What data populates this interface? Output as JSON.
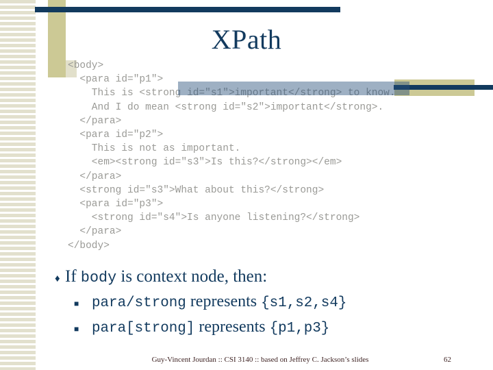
{
  "slide": {
    "title": "XPath",
    "colors": {
      "navy": "#123a5e",
      "khaki": "#ccc995",
      "stripe": "#e2e0cd",
      "code_gray": "#9a9a96",
      "footer_text": "#3b1f1f",
      "band_overlay": "rgba(41,80,122,0.45)"
    }
  },
  "code": {
    "language": "xml",
    "lines": [
      "<body>",
      "  <para id=\"p1\">",
      "    This is <strong id=\"s1\">important</strong> to know.",
      "    And I do mean <strong id=\"s2\">important</strong>.",
      "  </para>",
      "  <para id=\"p2\">",
      "    This is not as important.",
      "    <em><strong id=\"s3\">Is this?</strong></em>",
      "  </para>",
      "  <strong id=\"s3\">What about this?</strong>",
      "  <para id=\"p3\">",
      "    <strong id=\"s4\">Is anyone listening?</strong>",
      "  </para>",
      "</body>"
    ]
  },
  "bullets": {
    "level1": {
      "marker": "diamond-bullet",
      "marker_glyph": "♦",
      "parts": [
        {
          "text": "If ",
          "style": "serif"
        },
        {
          "text": "body",
          "style": "mono"
        },
        {
          "text": " is context node, then:",
          "style": "serif"
        }
      ]
    },
    "level2": [
      {
        "marker": "square-bullet",
        "marker_glyph": "■",
        "parts": [
          {
            "text": "para/strong",
            "style": "mono"
          },
          {
            "text": " represents ",
            "style": "serif"
          },
          {
            "text": "{s1,s2,s4}",
            "style": "mono"
          }
        ]
      },
      {
        "marker": "square-bullet",
        "marker_glyph": "■",
        "parts": [
          {
            "text": "para[strong]",
            "style": "mono"
          },
          {
            "text": " represents ",
            "style": "serif"
          },
          {
            "text": "{p1,p3}",
            "style": "mono"
          }
        ]
      }
    ]
  },
  "footer": {
    "credit": "Guy-Vincent Jourdan :: CSI 3140 :: based on Jeffrey C. Jackson’s slides",
    "page_number": "62"
  }
}
